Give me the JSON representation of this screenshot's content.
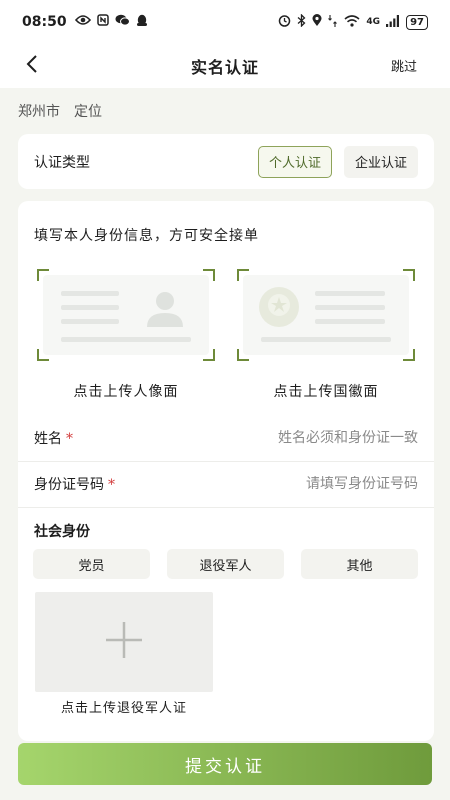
{
  "status_bar": {
    "time": "08:50",
    "left_icons": [
      "eye-icon",
      "nfc-icon",
      "wechat-icon",
      "qq-icon"
    ],
    "right_icons": [
      "alarm-icon",
      "bluetooth-icon",
      "location-icon",
      "data-speed-icon",
      "wifi-icon",
      "signal-icon"
    ],
    "network": "4G",
    "battery": "97"
  },
  "nav": {
    "title": "实名认证",
    "skip_label": "跳过"
  },
  "location": {
    "city": "郑州市",
    "locate_label": "定位"
  },
  "auth_type": {
    "label": "认证类型",
    "options": [
      "个人认证",
      "企业认证"
    ],
    "selected": "个人认证"
  },
  "form": {
    "intro": "填写本人身份信息，方可安全接单",
    "upload_front_caption": "点击上传人像面",
    "upload_back_caption": "点击上传国徽面",
    "name_label": "姓名",
    "name_placeholder": "姓名必须和身份证一致",
    "id_label": "身份证号码",
    "id_placeholder": "请填写身份证号码",
    "required_mark": "*",
    "social_title": "社会身份",
    "social_options": [
      "党员",
      "退役军人",
      "其他"
    ],
    "veteran_upload_caption": "点击上传退役军人证"
  },
  "submit_label": "提交认证",
  "colors": {
    "accent": "#6e8a39",
    "required": "#d23a3a",
    "button_start": "#a5d56c",
    "button_end": "#6f9b3c"
  }
}
